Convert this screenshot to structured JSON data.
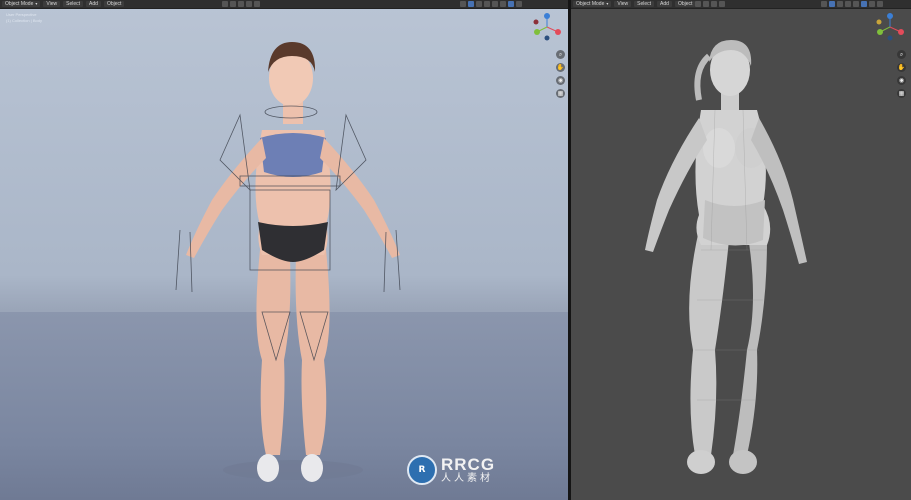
{
  "left_viewport": {
    "header": {
      "mode": "Object Mode",
      "menus": [
        "View",
        "Select",
        "Add",
        "Object"
      ]
    },
    "overlay": {
      "line1": "User Perspective",
      "line2": "(1) Collection | Body"
    },
    "nav_icons": [
      "zoom-icon",
      "hand-icon",
      "camera-icon",
      "grid-icon"
    ]
  },
  "right_viewport": {
    "header": {
      "mode": "Object Mode",
      "menus": [
        "View",
        "Select",
        "Add",
        "Object"
      ]
    },
    "nav_icons": [
      "zoom-icon",
      "hand-icon",
      "camera-icon",
      "grid-icon"
    ]
  },
  "watermark": {
    "name": "RRCG",
    "subtitle": "人人素材",
    "logo_text": "R"
  },
  "colors": {
    "blender_header": "#2f2f2f",
    "viewport_left_bg": "#b9c4d4",
    "viewport_right_bg": "#4b4b4b",
    "accent_blue": "#4772b3",
    "axis_x": "#e34b5a",
    "axis_y": "#7fbf3b",
    "axis_z": "#3b7fd6"
  }
}
